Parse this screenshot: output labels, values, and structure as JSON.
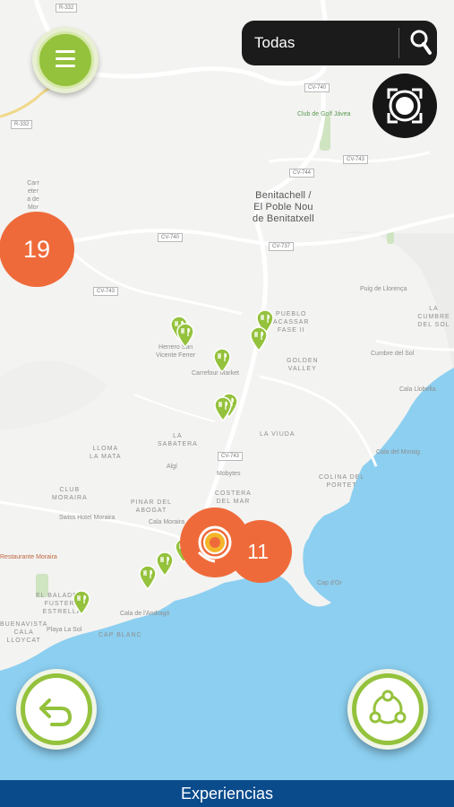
{
  "search": {
    "value": "Todas",
    "icon": "search-icon"
  },
  "menu": {
    "icon": "menu-icon"
  },
  "locate": {
    "icon": "locate-icon"
  },
  "back": {
    "icon": "back-arrow-icon"
  },
  "network": {
    "icon": "network-icon"
  },
  "bottom_bar": {
    "label": "Experiencias"
  },
  "colors": {
    "accent_green": "#94c23c",
    "cluster_orange": "#ef6a3a",
    "bottom_blue": "#0a4b8c",
    "sea": "#8ccff0"
  },
  "clusters": [
    {
      "label": "19"
    },
    {
      "label": "11"
    }
  ],
  "map_labels": {
    "town": "Benitachell /\nEl Poble Nou\nde Benitatxell",
    "club_golf": "Club de Golf Jávea",
    "pueblo_acassar": "PUEBLO\nACASSAR\nFASE II",
    "golden_valley": "GOLDEN\nVALLEY",
    "la_viuda": "LA VIUDA",
    "la_sabatera": "LA\nSABATERA",
    "lloma_mata": "LLOMA\nLA MATA",
    "club_moraira": "CLUB\nMORAIRA",
    "pinar_abogat": "PINAR DEL\nABOGAT",
    "costera_mar": "COSTERA\nDEL MAR",
    "colina_sol": "COLINA DEL\nPORTET",
    "la_cumbre": "LA CUMBRE\nDEL SOL",
    "el_baladrar": "EL BALADRAR\nFUSTERA\nESTRELLA",
    "buenavista": "BUENAVISTA\nCALA\nLLOYCAT",
    "cap_blanc": "CAP BLANC",
    "herrero": "Herrero San\nVicente Ferrer",
    "carrefour": "Carrefour Market",
    "algi": "Algí",
    "mobytes": "Mobytes",
    "swiss_hotel": "Swiss Hotel Moraira",
    "restaurant": "Restaurante Moraira",
    "cala_andrago": "Cala de l'Andragó",
    "playa_sol": "Playa La Sol",
    "cala_moraig": "Cala del Moraig",
    "cumbre_sol": "Cumbre del Sol",
    "puig_llorenca": "Puig de Llorença",
    "cap_or": "Cap d'Or",
    "cala_llobella": "Cala Llobella",
    "cala_moraira": "Cala Moraira",
    "carretera": "Carretera de Moraira"
  },
  "road_labels": [
    "R-332",
    "R-332",
    "CV-740",
    "CV-744",
    "CV-743",
    "CV-740",
    "CV-737",
    "CV-743",
    "CV-743"
  ]
}
